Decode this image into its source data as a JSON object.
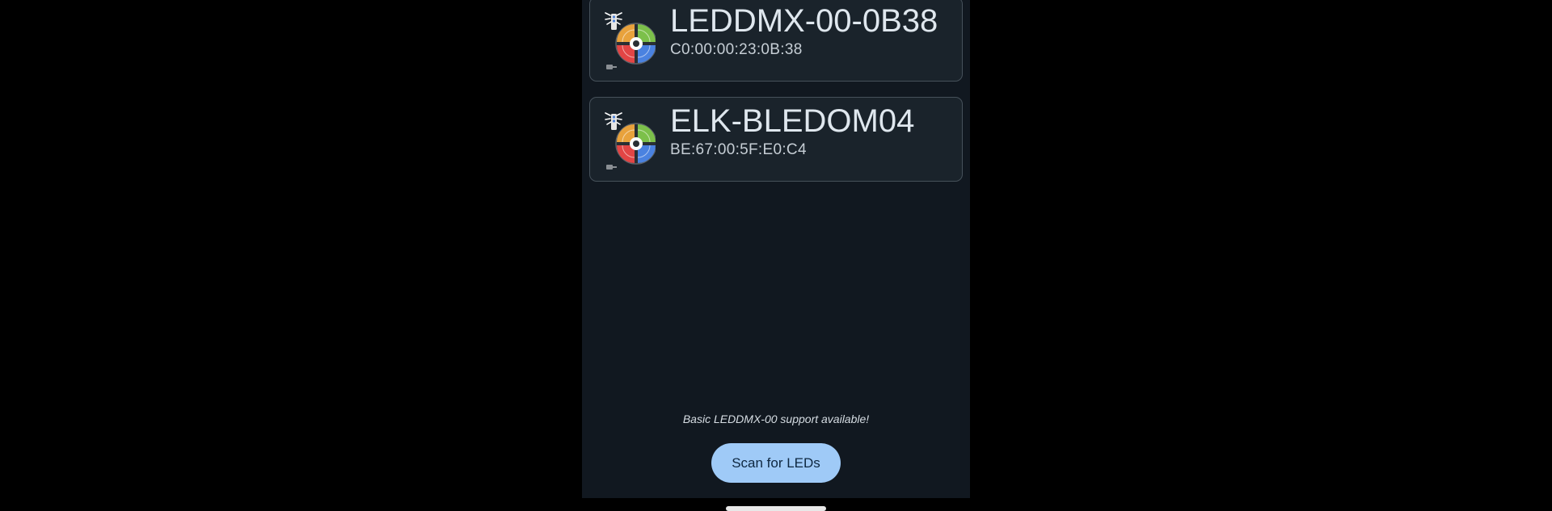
{
  "devices": [
    {
      "name": "LEDDMX-00-0B38",
      "mac": "C0:00:00:23:0B:38",
      "icon": "led-strip-icon"
    },
    {
      "name": "ELK-BLEDOM04",
      "mac": "BE:67:00:5F:E0:C4",
      "icon": "led-strip-icon"
    }
  ],
  "support_note": "Basic LEDDMX-00 support available!",
  "scan_button_label": "Scan for LEDs",
  "colors": {
    "background": "#000000",
    "screen": "#111820",
    "card": "#1a232b",
    "card_border": "#46515a",
    "button": "#9fcaf7",
    "button_text": "#0e2740"
  }
}
